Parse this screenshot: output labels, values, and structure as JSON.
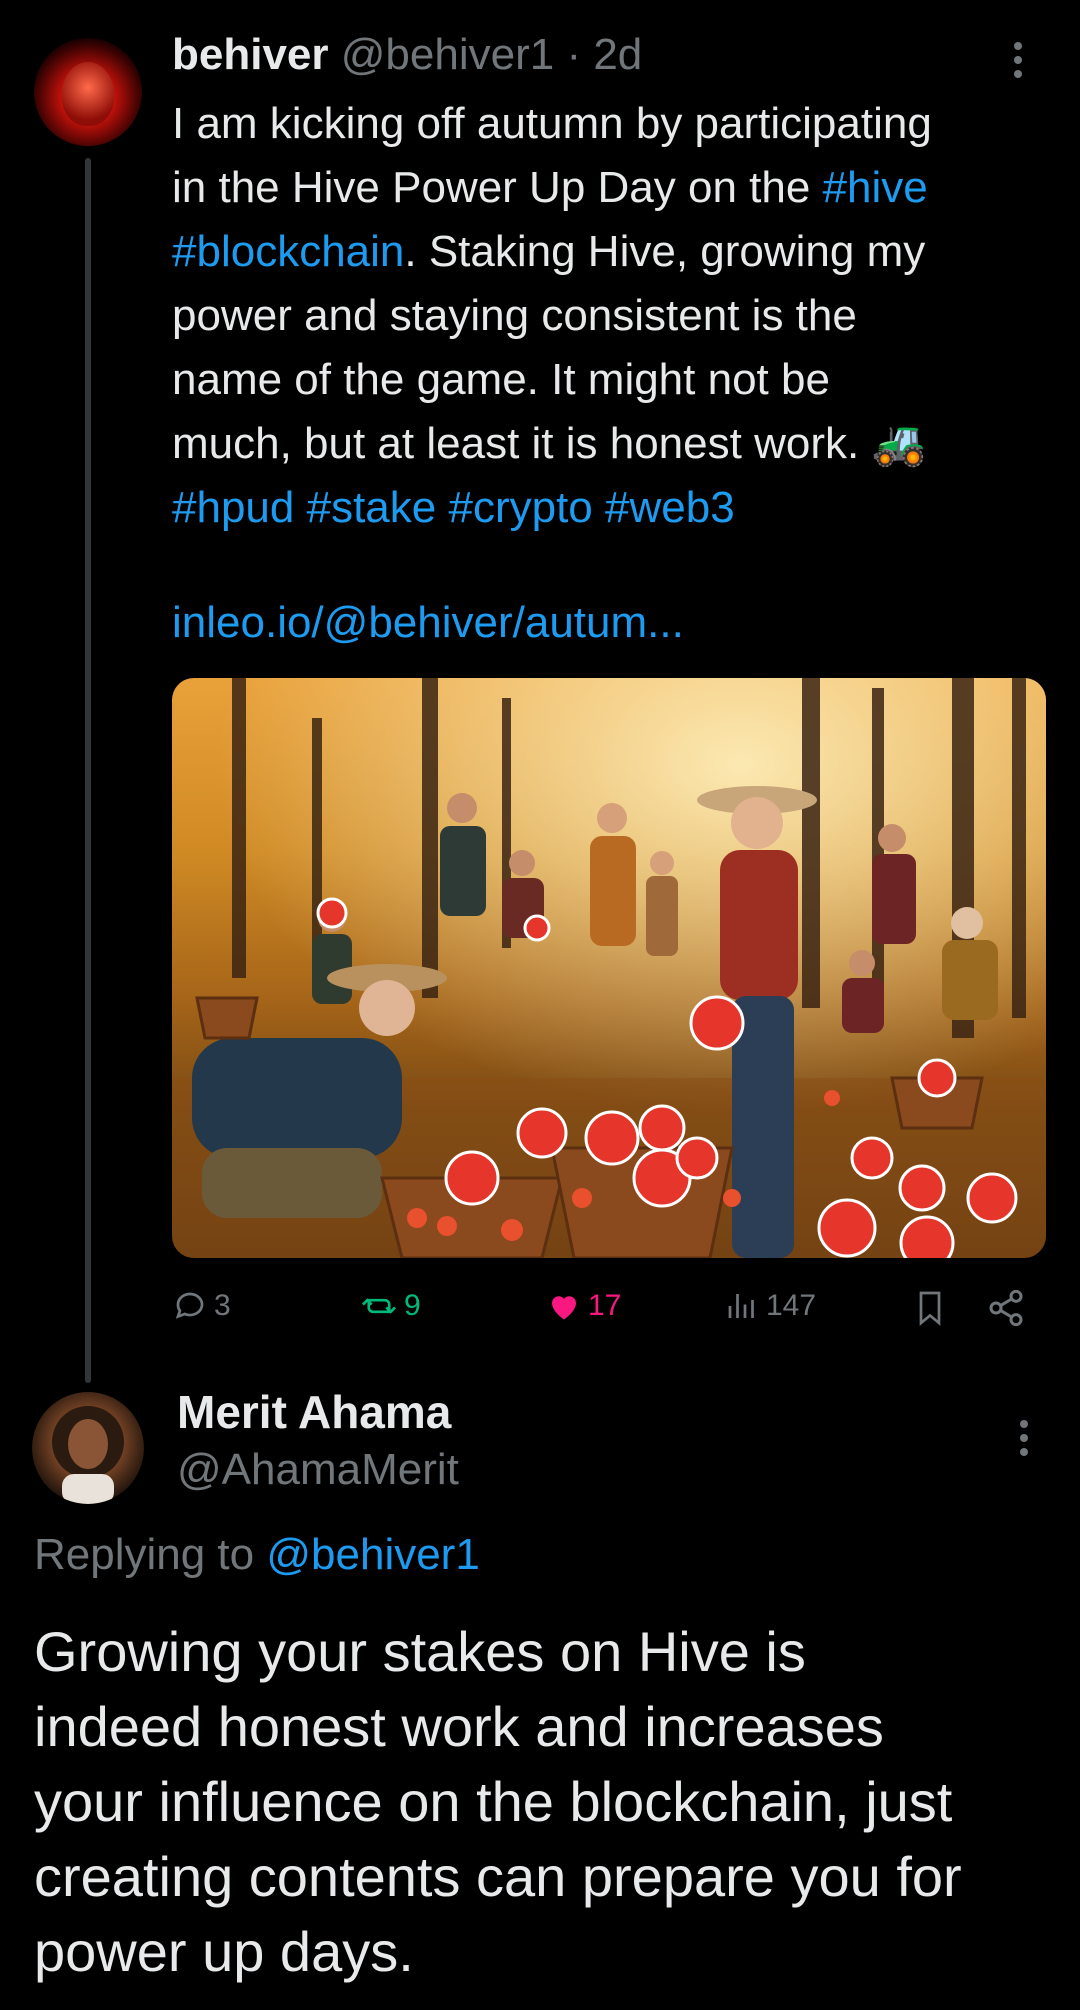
{
  "tweet": {
    "display_name": "behiver",
    "handle": "@behiver1",
    "separator": "·",
    "time": "2d",
    "text_lines": [
      [
        {
          "t": "I am kicking off autumn by participating",
          "link": false
        }
      ],
      [
        {
          "t": "in the Hive Power Up Day on the ",
          "link": false
        },
        {
          "t": "#hive",
          "link": true
        }
      ],
      [
        {
          "t": "#blockchain",
          "link": true
        },
        {
          "t": ". Staking Hive, growing my",
          "link": false
        }
      ],
      [
        {
          "t": "power and staying consistent is the",
          "link": false
        }
      ],
      [
        {
          "t": "name of the game. It might not be",
          "link": false
        }
      ],
      [
        {
          "t": "much, but at least it is honest work. ",
          "link": false
        },
        {
          "t": "🚜",
          "link": false
        }
      ],
      [
        {
          "t": "#hpud",
          "link": true
        },
        {
          "t": " ",
          "link": false
        },
        {
          "t": "#stake",
          "link": true
        },
        {
          "t": " ",
          "link": false
        },
        {
          "t": "#crypto",
          "link": true
        },
        {
          "t": " ",
          "link": false
        },
        {
          "t": "#web3",
          "link": true
        }
      ]
    ],
    "link": "inleo.io/@behiver/autum...",
    "stats": {
      "replies": "3",
      "reposts": "9",
      "likes": "17",
      "views": "147"
    },
    "colors": {
      "link": "#1d9bf0",
      "repost": "#00ba7c",
      "like": "#f91880",
      "muted": "#71767b"
    }
  },
  "reply": {
    "display_name": "Merit Ahama",
    "handle": "@AhamaMerit",
    "replying_prefix": "Replying to ",
    "replying_to": "@behiver1",
    "text_lines": [
      "Growing your stakes on Hive is",
      "indeed honest work and increases",
      "your influence on the blockchain, just",
      "creating contents can prepare you for",
      "power up days."
    ]
  }
}
